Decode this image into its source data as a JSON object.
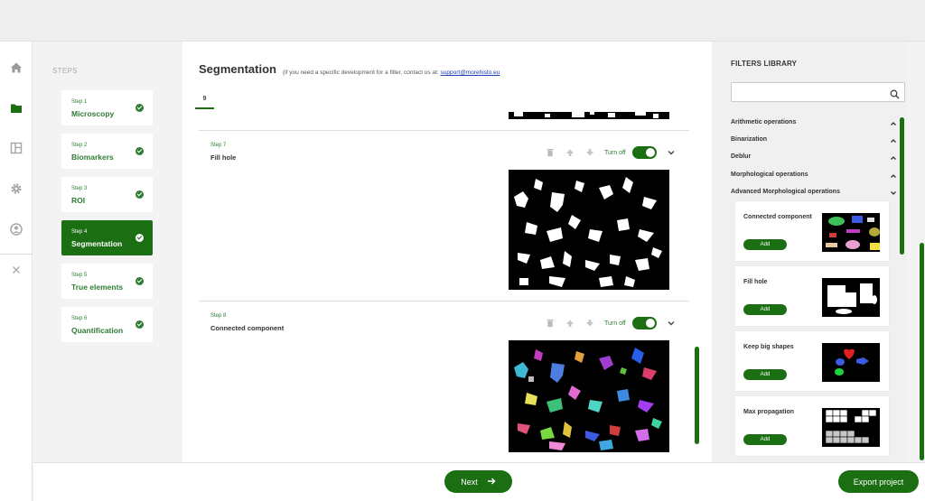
{
  "steps": {
    "title": "STEPS",
    "items": [
      {
        "num": "Step 1",
        "label": "Microscopy"
      },
      {
        "num": "Step 2",
        "label": "Biomarkers"
      },
      {
        "num": "Step 3",
        "label": "ROI"
      },
      {
        "num": "Step 4",
        "label": "Segmentation"
      },
      {
        "num": "Step 5",
        "label": "True elements"
      },
      {
        "num": "Step 6",
        "label": "Quantification"
      }
    ]
  },
  "main": {
    "title": "Segmentation",
    "note": "(if you need a specific development for a filter, contact us at: ",
    "email": "support@morehisto.eu",
    "tab": "9",
    "cards": [
      {
        "num": "Step 7",
        "name": "Fill hole",
        "toggle": "Turn off"
      },
      {
        "num": "Step 8",
        "name": "Connected component",
        "toggle": "Turn off"
      }
    ]
  },
  "library": {
    "title": "FILTERS LIBRARY",
    "search_placeholder": "",
    "categories": [
      "Arithmetic operations",
      "Binarization",
      "Deblur",
      "Morphological operations",
      "Advanced Morphological operations"
    ],
    "filters": [
      {
        "name": "Connected component",
        "add": "Add"
      },
      {
        "name": "Fill hole",
        "add": "Add"
      },
      {
        "name": "Keep big shapes",
        "add": "Add"
      },
      {
        "name": "Max propagation",
        "add": "Add"
      }
    ]
  },
  "footer": {
    "next": "Next",
    "export": "Export project"
  },
  "colors": {
    "accent": "#1b6e12",
    "text_green": "#2e7d32"
  },
  "icons": [
    "home-icon",
    "folder-icon",
    "layout-icon",
    "gear-icon",
    "user-icon",
    "close-icon",
    "trash-icon",
    "arrow-up-icon",
    "arrow-down-icon",
    "chevron-down-icon",
    "search-icon",
    "arrow-right-icon"
  ]
}
